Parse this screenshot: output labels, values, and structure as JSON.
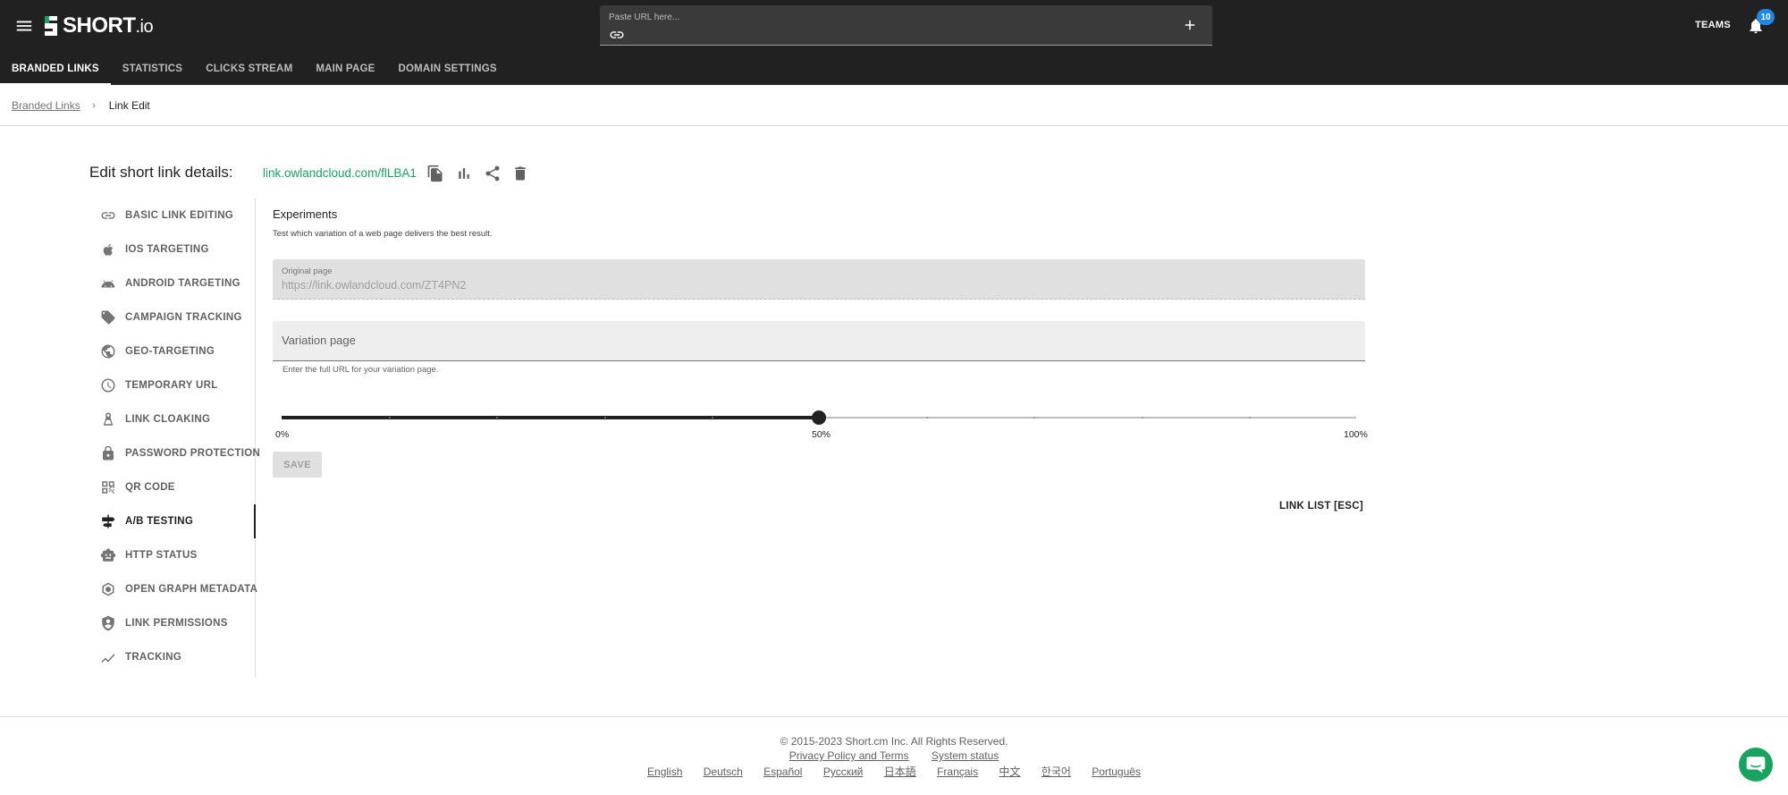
{
  "brand": {
    "logo_text": "SHORT",
    "logo_suffix": ".io"
  },
  "header": {
    "url_placeholder": "Paste URL here...",
    "teams_label": "TEAMS",
    "notification_count": "10"
  },
  "tabs": [
    {
      "label": "BRANDED LINKS",
      "active": true
    },
    {
      "label": "STATISTICS"
    },
    {
      "label": "CLICKS STREAM"
    },
    {
      "label": "MAIN PAGE"
    },
    {
      "label": "DOMAIN SETTINGS"
    }
  ],
  "breadcrumb": {
    "parent": "Branded Links",
    "current": "Link Edit"
  },
  "page": {
    "title": "Edit short link details:",
    "short_url": "link.owlandcloud.com/flLBA1"
  },
  "sidebar": {
    "items": [
      {
        "label": "BASIC LINK EDITING",
        "icon": "link-icon"
      },
      {
        "label": "IOS TARGETING",
        "icon": "apple-icon"
      },
      {
        "label": "ANDROID TARGETING",
        "icon": "android-icon"
      },
      {
        "label": "CAMPAIGN TRACKING",
        "icon": "tag-icon"
      },
      {
        "label": "GEO-TARGETING",
        "icon": "globe-icon"
      },
      {
        "label": "TEMPORARY URL",
        "icon": "clock-icon"
      },
      {
        "label": "LINK CLOAKING",
        "icon": "cloak-icon"
      },
      {
        "label": "PASSWORD PROTECTION",
        "icon": "lock-icon"
      },
      {
        "label": "QR CODE",
        "icon": "qr-code-icon"
      },
      {
        "label": "A/B TESTING",
        "icon": "split-icon",
        "active": true
      },
      {
        "label": "HTTP STATUS",
        "icon": "robot-icon"
      },
      {
        "label": "OPEN GRAPH METADATA",
        "icon": "graph-icon"
      },
      {
        "label": "LINK PERMISSIONS",
        "icon": "shield-person-icon"
      },
      {
        "label": "TRACKING",
        "icon": "trending-icon"
      }
    ]
  },
  "experiments": {
    "title": "Experiments",
    "subtitle": "Test which variation of a web page delivers the best result.",
    "original_label": "Original page",
    "original_value": "https://link.owlandcloud.com/ZT4PN2",
    "variation_placeholder": "Variation page",
    "helper": "Enter the full URL for your variation page.",
    "slider": {
      "value": 50,
      "min": 0,
      "max": 100,
      "step": 5,
      "min_label": "0%",
      "value_label": "50%",
      "max_label": "100%"
    },
    "save_label": "SAVE",
    "link_list_label": "LINK LIST [ESC]"
  },
  "footer": {
    "copyright": "© 2015-2023  Short.cm Inc. All Rights Reserved.",
    "privacy": "Privacy Policy and Terms",
    "status": "System status",
    "languages": [
      "English",
      "Deutsch",
      "Español",
      "Русский",
      "日本語",
      "Français",
      "中文",
      "한국어",
      "Português"
    ]
  },
  "colors": {
    "topbar": "#212121",
    "accent_green": "#1aa260",
    "badge_blue": "#1e88e5"
  }
}
